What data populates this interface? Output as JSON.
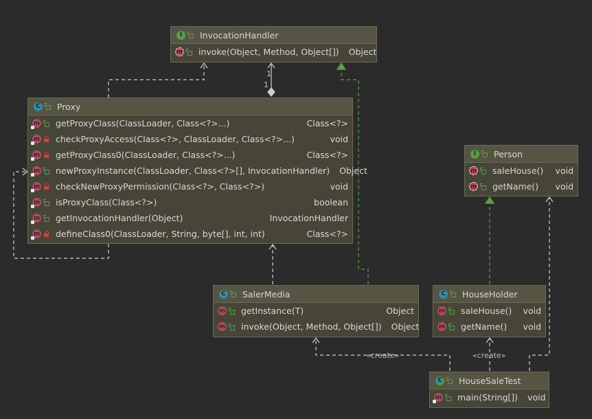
{
  "diagram": {
    "nodes": {
      "invocation_handler": {
        "name": "InvocationHandler",
        "badge": "I",
        "kind": "interface",
        "methods": [
          {
            "badge": "m",
            "name": "invoke(Object, Method, Object[])",
            "type": "Object"
          }
        ]
      },
      "proxy": {
        "name": "Proxy",
        "badge": "C",
        "kind": "class",
        "methods": [
          {
            "badge": "m",
            "name": "getProxyClass(ClassLoader, Class<?>...)",
            "type": "Class<?>"
          },
          {
            "badge": "m",
            "name": "checkProxyAccess(Class<?>, ClassLoader, Class<?>...)",
            "type": "void"
          },
          {
            "badge": "m",
            "name": "getProxyClass0(ClassLoader, Class<?>...)",
            "type": "Class<?>"
          },
          {
            "badge": "m",
            "name": "newProxyInstance(ClassLoader, Class<?>[], InvocationHandler)",
            "type": "Object"
          },
          {
            "badge": "m",
            "name": "checkNewProxyPermission(Class<?>, Class<?>)",
            "type": "void"
          },
          {
            "badge": "m",
            "name": "isProxyClass(Class<?>)",
            "type": "boolean"
          },
          {
            "badge": "m",
            "name": "getInvocationHandler(Object)",
            "type": "InvocationHandler"
          },
          {
            "badge": "m",
            "name": "defineClass0(ClassLoader, String, byte[], int, int)",
            "type": "Class<?>"
          }
        ]
      },
      "person": {
        "name": "Person",
        "badge": "I",
        "kind": "interface",
        "methods": [
          {
            "badge": "m",
            "name": "saleHouse()",
            "type": "void"
          },
          {
            "badge": "m",
            "name": "getName()",
            "type": "void"
          }
        ]
      },
      "saler_media": {
        "name": "SalerMedia",
        "badge": "C",
        "kind": "class",
        "methods": [
          {
            "badge": "m",
            "name": "getInstance(T)",
            "type": "Object"
          },
          {
            "badge": "m",
            "name": "invoke(Object, Method, Object[])",
            "type": "Object"
          }
        ]
      },
      "house_holder": {
        "name": "HouseHolder",
        "badge": "C",
        "kind": "class",
        "methods": [
          {
            "badge": "m",
            "name": "saleHouse()",
            "type": "void"
          },
          {
            "badge": "m",
            "name": "getName()",
            "type": "void"
          }
        ]
      },
      "house_sale_test": {
        "name": "HouseSaleTest",
        "badge": "C",
        "kind": "class",
        "methods": [
          {
            "badge": "m",
            "name": "main(String[])",
            "type": "void"
          }
        ]
      }
    },
    "edge_labels": {
      "multiplicity_top": "1",
      "multiplicity_bottom": "1",
      "create_saler_media": "«create»",
      "create_house_holder": "«create»"
    }
  }
}
